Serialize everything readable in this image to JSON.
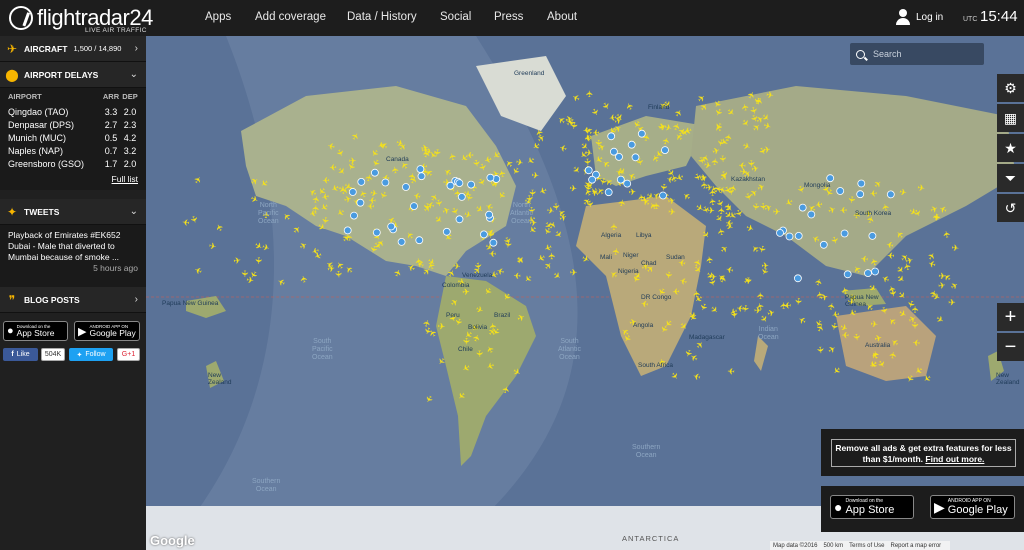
{
  "header": {
    "brand": "flightradar24",
    "tagline": "LIVE AIR TRAFFIC",
    "nav": [
      "Apps",
      "Add coverage",
      "Data / History",
      "Social",
      "Press",
      "About"
    ],
    "login": "Log in",
    "tz": "UTC",
    "time": "15:44"
  },
  "sidebar": {
    "aircraft_label": "AIRCRAFT",
    "aircraft_count": "1,500 / 14,890",
    "delays_label": "AIRPORT DELAYS",
    "delays_headers": [
      "AIRPORT",
      "ARR",
      "DEP"
    ],
    "delays_rows": [
      {
        "airport": "Qingdao (TAO)",
        "arr": "3.3",
        "dep": "2.0"
      },
      {
        "airport": "Denpasar (DPS)",
        "arr": "2.7",
        "dep": "2.3"
      },
      {
        "airport": "Munich (MUC)",
        "arr": "0.5",
        "dep": "4.2"
      },
      {
        "airport": "Naples (NAP)",
        "arr": "0.7",
        "dep": "3.2"
      },
      {
        "airport": "Greensboro (GSO)",
        "arr": "1.7",
        "dep": "2.0"
      }
    ],
    "full_list": "Full list",
    "tweets_label": "TWEETS",
    "tweet_text": "Playback of Emirates #EK652 Dubai - Male that diverted to Mumbai because of smoke ...",
    "tweet_time": "5 hours ago",
    "blog_label": "BLOG POSTS",
    "appstore_small": "Download on the",
    "appstore_big": "App Store",
    "googleplay_small": "ANDROID APP ON",
    "googleplay_big": "Google Play",
    "fb_like": "Like",
    "fb_count": "504K",
    "tw_follow": "Follow",
    "gplus": "G+1"
  },
  "map": {
    "search_placeholder": "Search",
    "labels": {
      "greenland": "Greenland",
      "canada": "Canada",
      "finland": "Finland",
      "kazakhstan": "Kazakhstan",
      "mongolia": "Mongolia",
      "algeria": "Algeria",
      "libya": "Libya",
      "mali": "Mali",
      "niger": "Niger",
      "chad": "Chad",
      "sudan": "Sudan",
      "nigeria": "Nigeria",
      "venezuela": "Venezuela",
      "colombia": "Colombia",
      "brazil": "Brazil",
      "peru": "Peru",
      "bolivia": "Bolivia",
      "chile": "Chile",
      "dr_congo": "DR Congo",
      "angola": "Angola",
      "madagascar": "Madagascar",
      "south_africa": "South Africa",
      "australia": "Australia",
      "png": "Papua New Guinea",
      "png2": "Papua New\nGuinea",
      "nz": "New\nZealand",
      "nz2": "New\nZealand",
      "antarctica": "ANTARCTICA",
      "north_atlantic": "North\nAtlantic\nOcean",
      "south_atlantic": "South\nAtlantic\nOcean",
      "south_pacific": "South\nPacific\nOcean",
      "north_pacific": "North\nPacific\nOcean",
      "indian_ocean": "Indian\nOcean",
      "southern_ocean": "Southern\nOcean",
      "southern_ocean2": "Southern\nOcean",
      "south_korea": "South Korea"
    },
    "footer": [
      "Map data ©2016",
      "500 km",
      "Terms of Use",
      "Report a map error"
    ],
    "google": "Google"
  },
  "promo": {
    "line": "Remove all ads & get extra features for less than $1/month.",
    "link": "Find out more."
  },
  "colors": {
    "aircraft": "#f6e21a",
    "accent": "#f7b500",
    "airport_pin": "#4a9be0"
  }
}
